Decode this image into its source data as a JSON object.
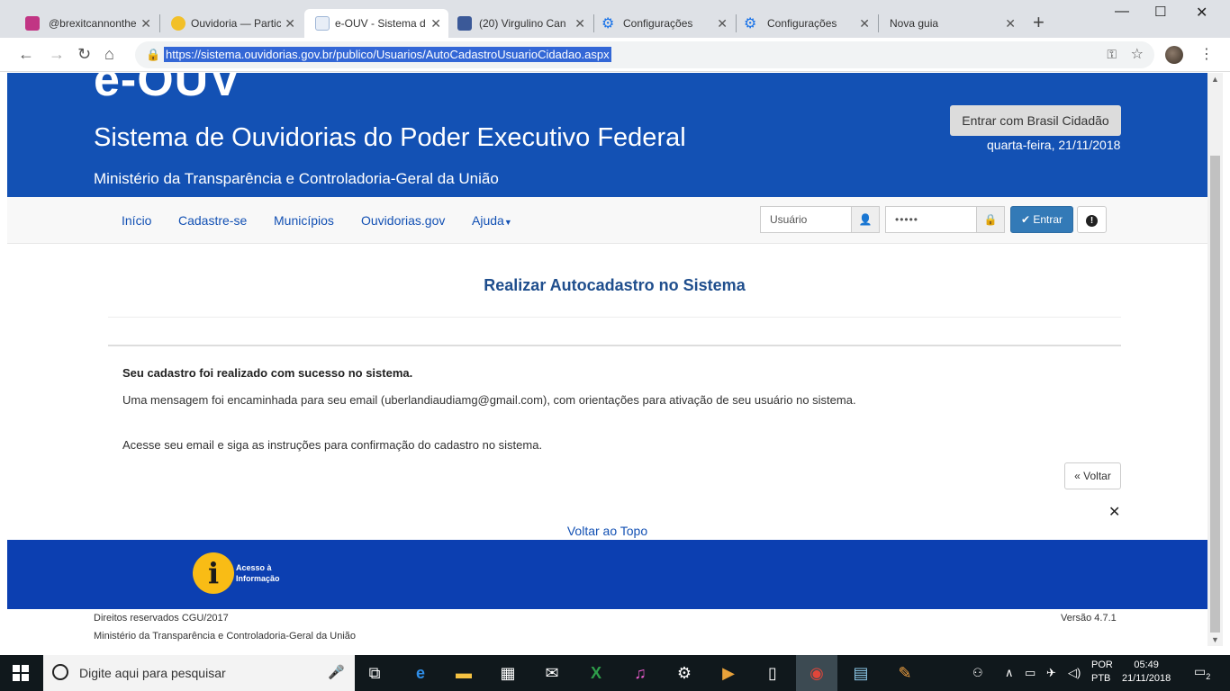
{
  "browser": {
    "tabs": [
      {
        "title": "@brexitcannonthe",
        "icon_color": "#c13584"
      },
      {
        "title": "Ouvidoria — Partic",
        "icon_color": "#f2c029"
      },
      {
        "title": "e-OUV - Sistema d",
        "icon_color": "#b0c4de"
      },
      {
        "title": "(20) Virgulino Can",
        "icon_color": "#3b5998"
      },
      {
        "title": "Configurações",
        "icon_color": "#1a73e8"
      },
      {
        "title": "Configurações",
        "icon_color": "#1a73e8"
      },
      {
        "title": "Nova guia",
        "icon_color": ""
      }
    ],
    "url": "https://sistema.ouvidorias.gov.br/publico/Usuarios/AutoCadastroUsuarioCidadao.aspx"
  },
  "header": {
    "logo": "e-OUV",
    "system_name": "Sistema de Ouvidorias do Poder Executivo Federal",
    "ministry": "Ministério da Transparência e Controladoria-Geral da União",
    "gov_login": "Entrar com Brasil Cidadão",
    "date": "quarta-feira, 21/11/2018"
  },
  "nav": {
    "items": [
      "Início",
      "Cadastre-se",
      "Municípios",
      "Ouvidorias.gov",
      "Ajuda"
    ],
    "user_placeholder": "Usuário",
    "password_value": "•••••",
    "login_label": "Entrar"
  },
  "main": {
    "title": "Realizar Autocadastro no Sistema",
    "success_title": "Seu cadastro foi realizado com sucesso no sistema.",
    "message1": "Uma mensagem foi encaminhada para seu email (uberlandiaudiamg@gmail.com), com orientações para ativação de seu usuário no sistema.",
    "message2": "Acesse seu email e siga as instruções para confirmação do cadastro no sistema.",
    "back_label": "« Voltar",
    "back_to_top": "Voltar ao Topo"
  },
  "footer": {
    "info_line1": "Acesso à",
    "info_line2": "Informação",
    "rights": "Direitos reservados CGU/2017",
    "ministry": "Ministério da Transparência e Controladoria-Geral da União",
    "version": "Versão 4.7.1"
  },
  "taskbar": {
    "search_placeholder": "Digite aqui para pesquisar",
    "lang1": "POR",
    "lang2": "PTB",
    "time": "05:49",
    "date": "21/11/2018",
    "notifications": "2"
  },
  "colors": {
    "header_blue": "#1351b4",
    "footer_blue": "#0c3fb1",
    "title_blue": "#1f4e8d"
  }
}
